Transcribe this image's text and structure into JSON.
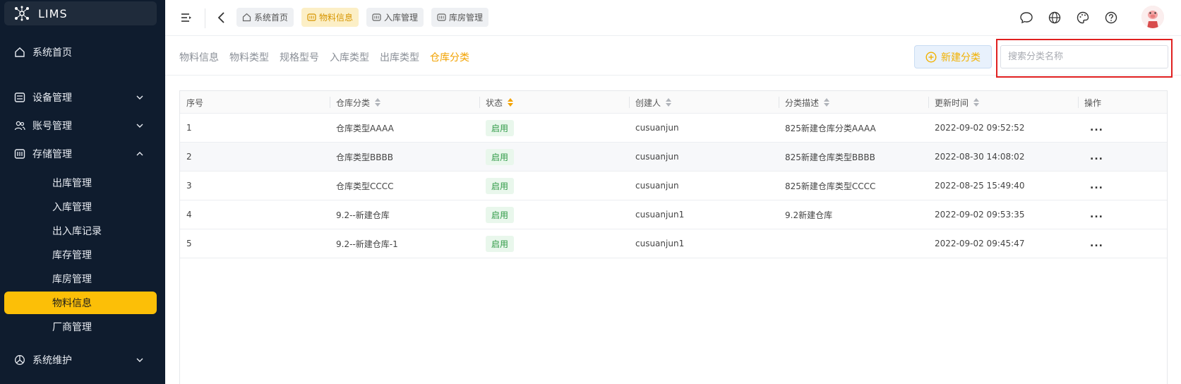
{
  "app": {
    "name": "LIMS"
  },
  "sidebar": {
    "home": "系统首页",
    "groups": [
      {
        "label": "设备管理",
        "icon": "device-icon",
        "expanded": false
      },
      {
        "label": "账号管理",
        "icon": "users-icon",
        "expanded": false
      },
      {
        "label": "存储管理",
        "icon": "storage-icon",
        "expanded": true
      },
      {
        "label": "系统维护",
        "icon": "maintenance-icon",
        "expanded": false
      }
    ],
    "storage_items": [
      "出库管理",
      "入库管理",
      "出入库记录",
      "库存管理",
      "库房管理",
      "物料信息",
      "厂商管理"
    ],
    "active_item": "物料信息",
    "accent": "#fcbf07"
  },
  "topbar": {
    "tags": [
      {
        "label": "系统首页",
        "icon": "home-icon",
        "active": false
      },
      {
        "label": "物料信息",
        "icon": "box-icon",
        "active": true
      },
      {
        "label": "入库管理",
        "icon": "box-icon",
        "active": false
      },
      {
        "label": "库房管理",
        "icon": "box-icon",
        "active": false
      }
    ],
    "icons": [
      "message-icon",
      "globe-icon",
      "palette-icon",
      "help-icon"
    ]
  },
  "subtabs": {
    "items": [
      "物料信息",
      "物料类型",
      "规格型号",
      "入库类型",
      "出库类型",
      "仓库分类"
    ],
    "active": "仓库分类",
    "new_button": "新建分类",
    "search_placeholder": "搜索分类名称"
  },
  "table": {
    "columns": [
      "序号",
      "仓库分类",
      "状态",
      "创建人",
      "分类描述",
      "更新时间",
      "操作"
    ],
    "rows": [
      [
        "1",
        "仓库类型AAAA",
        "启用",
        "cusuanjun",
        "825新建仓库分类AAAA",
        "2022-09-02 09:52:52",
        "..."
      ],
      [
        "2",
        "仓库类型BBBB",
        "启用",
        "cusuanjun",
        "825新建仓库类型BBBB",
        "2022-08-30 14:08:02",
        "..."
      ],
      [
        "3",
        "仓库类型CCCC",
        "启用",
        "cusuanjun",
        "825新建仓库类型CCCC",
        "2022-08-25 15:49:40",
        "..."
      ],
      [
        "4",
        "9.2--新建仓库",
        "启用",
        "cusuanjun1",
        "9.2新建仓库",
        "2022-09-02 09:53:35",
        "..."
      ],
      [
        "5",
        "9.2--新建仓库-1",
        "启用",
        "cusuanjun1",
        "",
        "2022-09-02 09:45:47",
        "..."
      ]
    ]
  }
}
